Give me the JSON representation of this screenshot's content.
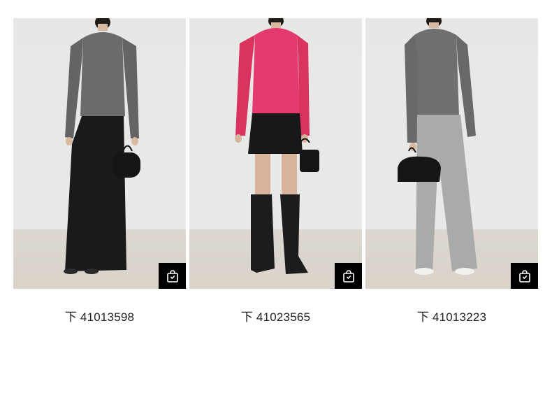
{
  "products": [
    {
      "caption": "下 41013598",
      "image": "model-grey-sweater-black-maxi-skirt",
      "colors": {
        "top": "#6b6b6d",
        "bottom": "#1a1a1c",
        "bag": "#151515",
        "shoes": "#2a2a2a"
      }
    },
    {
      "caption": "下 41023565",
      "image": "model-pink-sweater-black-mini-skirt-boots",
      "colors": {
        "top": "#e53a6d",
        "bottom": "#18181a",
        "bag": "#151515",
        "shoes": "#1c1c1c"
      }
    },
    {
      "caption": "下 41013223",
      "image": "model-grey-sweater-grey-wide-jeans",
      "colors": {
        "top": "#707072",
        "bottom": "#a9abab",
        "bag": "#151515",
        "shoes": "#f2f0ec"
      }
    }
  ],
  "shop_icon": "shopping-bag-icon"
}
